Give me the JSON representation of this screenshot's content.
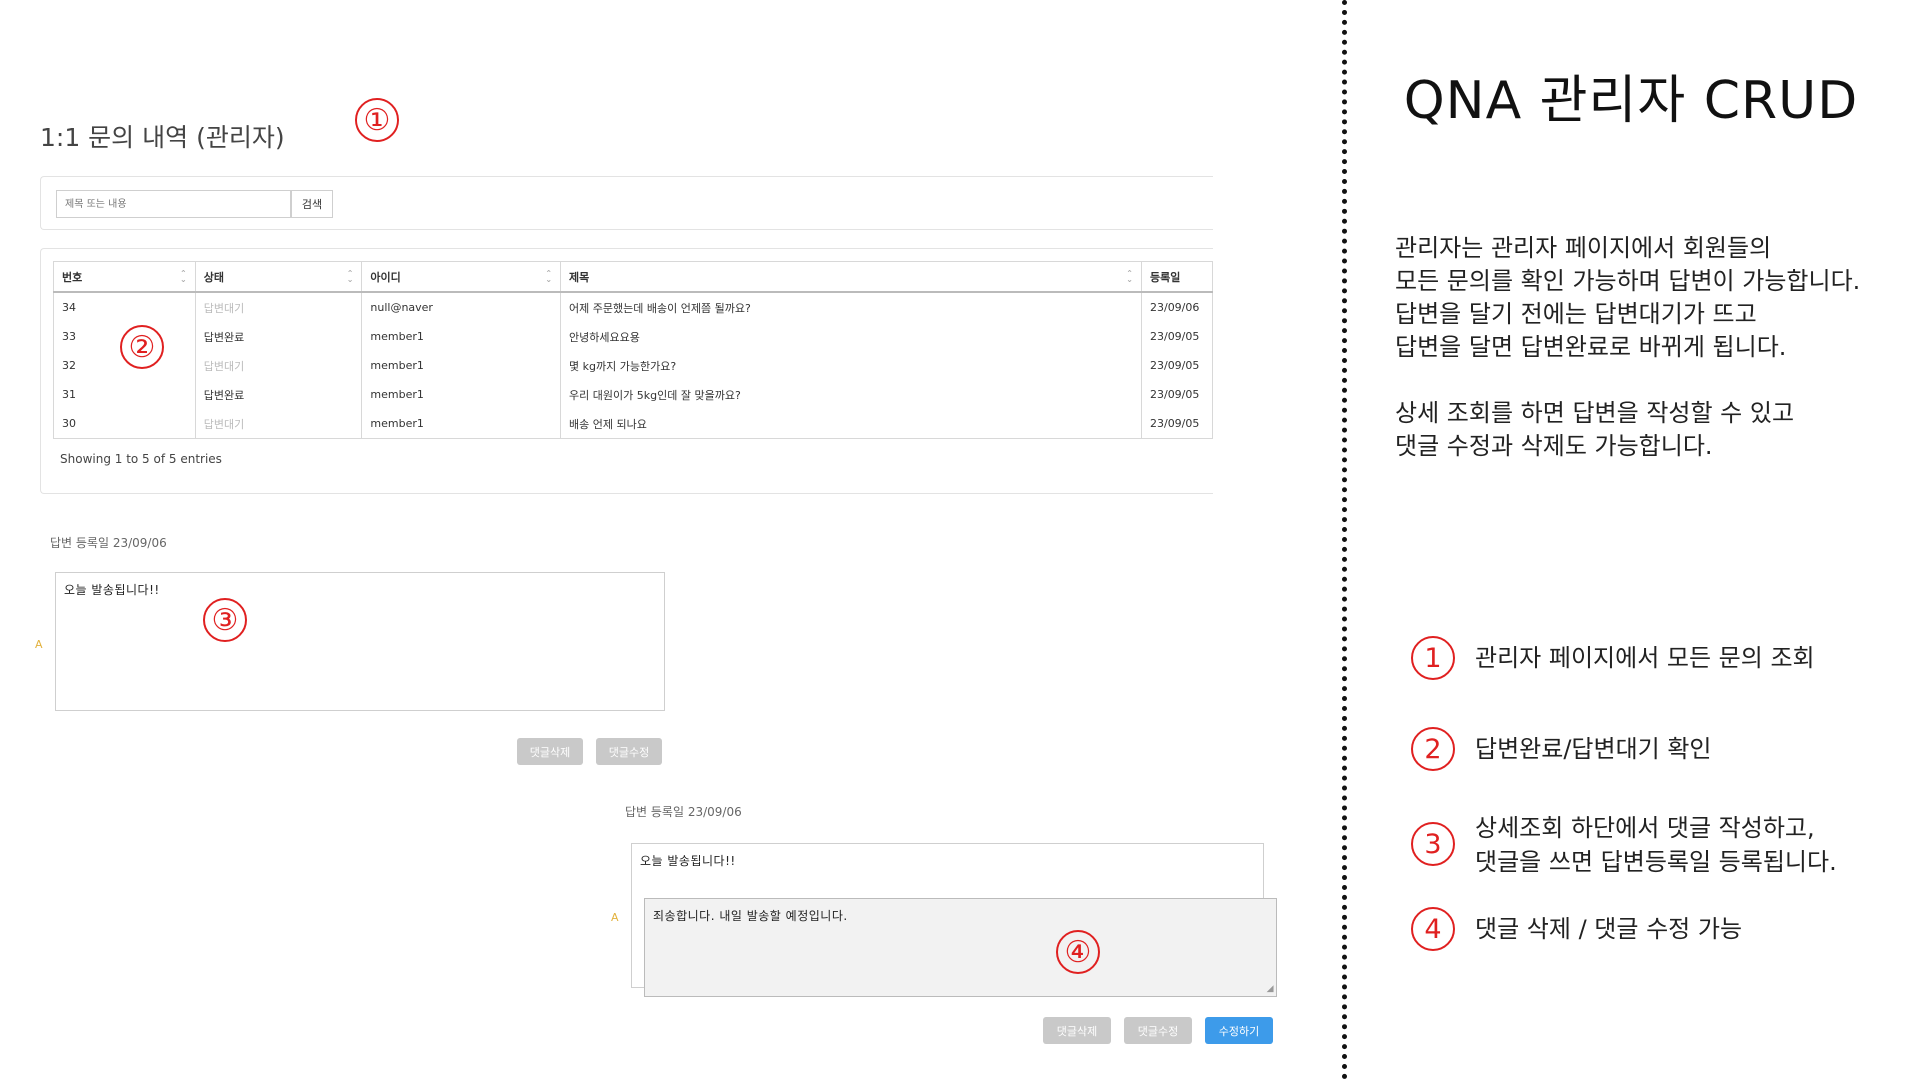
{
  "page": {
    "title": "1:1 문의 내역 (관리자)"
  },
  "search": {
    "placeholder": "제목 또는 내용",
    "button_label": "검색"
  },
  "table": {
    "columns": [
      "번호",
      "상태",
      "아이디",
      "제목",
      "등록일"
    ],
    "rows": [
      {
        "no": "34",
        "status": "답변대기",
        "id": "null@naver",
        "subject": "어제 주문했는데 배송이 언제쯤 될까요?",
        "date": "23/09/06"
      },
      {
        "no": "33",
        "status": "답변완료",
        "id": "member1",
        "subject": "안녕하세요요용",
        "date": "23/09/05"
      },
      {
        "no": "32",
        "status": "답변대기",
        "id": "member1",
        "subject": "몇 kg까지 가능한가요?",
        "date": "23/09/05"
      },
      {
        "no": "31",
        "status": "답변완료",
        "id": "member1",
        "subject": "우리 대원이가 5kg인데 잘 맞을까요?",
        "date": "23/09/05"
      },
      {
        "no": "30",
        "status": "답변대기",
        "id": "member1",
        "subject": "배송 언제 되나요",
        "date": "23/09/05"
      }
    ],
    "info": "Showing 1 to 5 of 5 entries"
  },
  "reply_view": {
    "date_label": "답변 등록일 23/09/06",
    "a_label": "A",
    "content": "오늘 발송됩니다!!",
    "delete_label": "댓글삭제",
    "edit_label": "댓글수정"
  },
  "reply_edit": {
    "date_label": "답변 등록일 23/09/06",
    "a_label": "A",
    "original": "오늘 발송됩니다!!",
    "edit_content": "죄송합니다. 내일 발송할 예정입니다.",
    "delete_label": "댓글삭제",
    "edit_label": "댓글수정",
    "submit_label": "수정하기"
  },
  "markers": [
    "①",
    "②",
    "③",
    "④"
  ],
  "panel": {
    "title": "QNA 관리자 CRUD",
    "description": "관리자는 관리자 페이지에서 회원들의\n모든 문의를 확인 가능하며 답변이 가능합니다.\n답변을 달기 전에는 답변대기가 뜨고\n답변을 달면 답변완료로 바뀌게 됩니다.\n\n상세 조회를 하면 답변을 작성할 수 있고\n댓글 수정과 삭제도 가능합니다.",
    "features": [
      {
        "marker": "1",
        "text": "관리자 페이지에서 모든 문의 조회"
      },
      {
        "marker": "2",
        "text": "답변완료/답변대기 확인"
      },
      {
        "marker": "3",
        "text": "상세조회 하단에서 댓글 작성하고,\n댓글을 쓰면 답변등록일 등록됩니다."
      },
      {
        "marker": "4",
        "text": "댓글 삭제 / 댓글 수정 가능"
      }
    ]
  },
  "colors": {
    "marker": "#e02020",
    "primary_button": "#3d9bea",
    "disabled_button": "#c9c9c9",
    "pending_status": "#bbbbbb"
  }
}
